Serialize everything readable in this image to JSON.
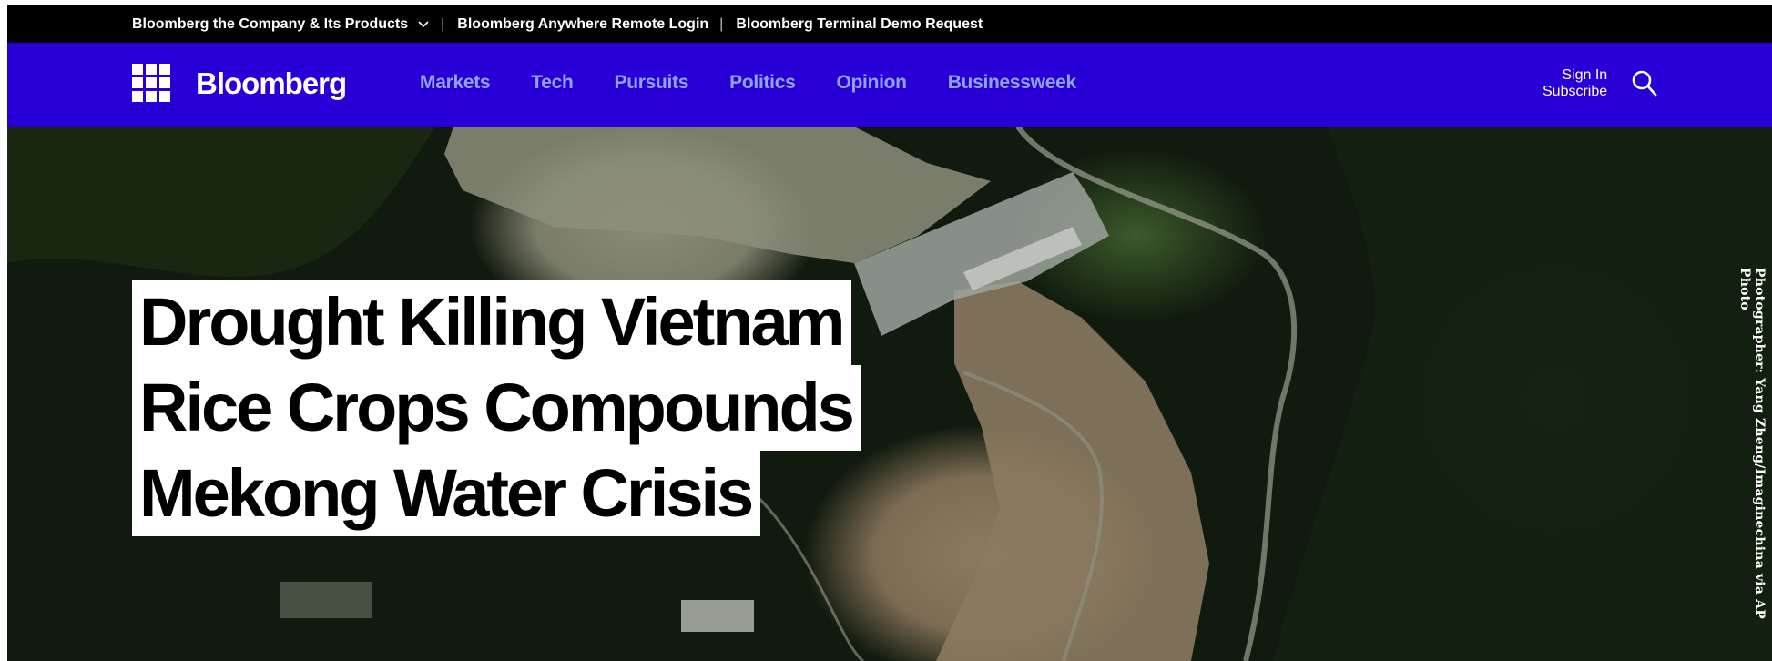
{
  "topbar": {
    "company_link": "Bloomberg the Company & Its Products",
    "remote_login": "Bloomberg Anywhere Remote Login",
    "demo_request": "Bloomberg Terminal Demo Request"
  },
  "nav": {
    "logo": "Bloomberg",
    "links": [
      "Markets",
      "Tech",
      "Pursuits",
      "Politics",
      "Opinion",
      "Businessweek"
    ],
    "sign_in": "Sign In",
    "subscribe": "Subscribe"
  },
  "hero": {
    "headline_lines": [
      "Drought Killing Vietnam",
      "Rice Crops Compounds",
      "Mekong Water Crisis"
    ],
    "photo_credit": "Photographer: Yang Zheng/Imaginechina via AP Photo"
  },
  "colors": {
    "topbar_bg": "#000000",
    "nav_bg": "#2800d7",
    "nav_link": "#8fa3ff"
  },
  "icons": {
    "menu": "grid-menu-icon",
    "search": "search-icon",
    "dropdown": "chevron-down-icon"
  }
}
